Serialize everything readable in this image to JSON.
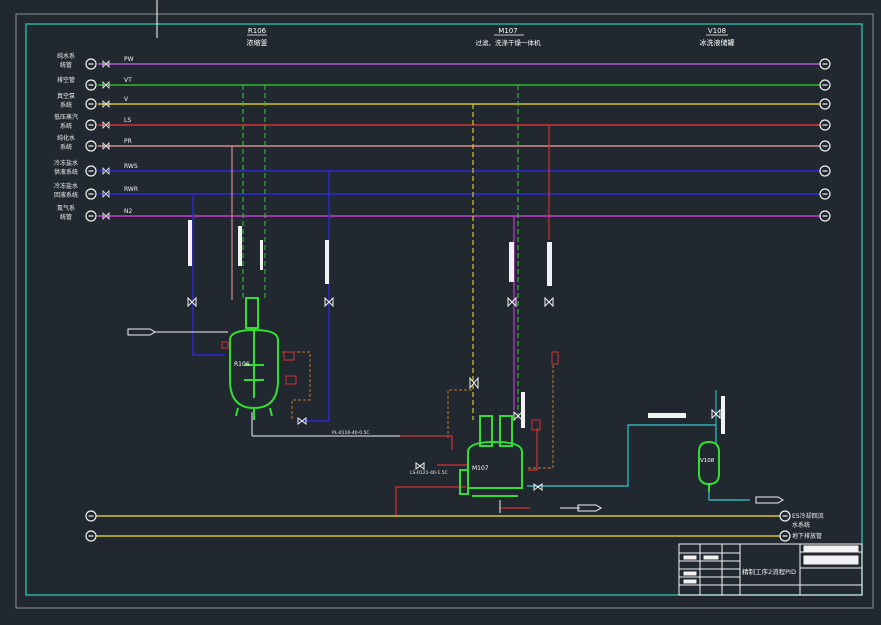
{
  "diagram": {
    "equipment": [
      {
        "tag": "R106",
        "name": "浓缩釜"
      },
      {
        "tag": "M107",
        "name": "过滤、洗涤干燥一体机"
      },
      {
        "tag": "V108",
        "name": "冰洗液储罐"
      }
    ],
    "utilities": [
      {
        "code": "PW",
        "label_lines": [
          "纯水系",
          "统管"
        ],
        "color": "#b15bd6"
      },
      {
        "code": "VT",
        "label_lines": [
          "排空管"
        ],
        "color": "#2dbb2d"
      },
      {
        "code": "V",
        "label_lines": [
          "真空泵",
          "系统"
        ],
        "color": "#d8c52c"
      },
      {
        "code": "LS",
        "label_lines": [
          "低压蒸汽",
          "系统"
        ],
        "color": "#d23232"
      },
      {
        "code": "PR",
        "label_lines": [
          "纯化水",
          "系统"
        ],
        "color": "#d98c8c"
      },
      {
        "code": "RWS",
        "label_lines": [
          "冷冻盐水",
          "供液系统"
        ],
        "color": "#2a2ad6"
      },
      {
        "code": "RWR",
        "label_lines": [
          "冷冻盐水",
          "回液系统"
        ],
        "color": "#2a2ad6"
      },
      {
        "code": "N2",
        "label_lines": [
          "氮气系",
          "统管"
        ],
        "color": "#c73bd1"
      }
    ],
    "bottom_lines": [
      {
        "label_lines": [
          "ES冷却回流",
          "水系统"
        ],
        "color": "#d8c52c"
      },
      {
        "label_lines": [
          "地下排放管"
        ],
        "color": "#d8c52c"
      }
    ],
    "line_numbers": [
      "PL-0110-40-0.5C",
      "LS-0121-40-1.5C"
    ],
    "title_block": {
      "drawing_title": "精制工序2流程PID"
    },
    "colors": {
      "background": "#212830",
      "border": "#2fb6a4",
      "vessel": "#33dd33",
      "white": "#f2f2f2",
      "cyan_line": "#35c7cf",
      "orange_dash": "#c87a2a"
    }
  }
}
